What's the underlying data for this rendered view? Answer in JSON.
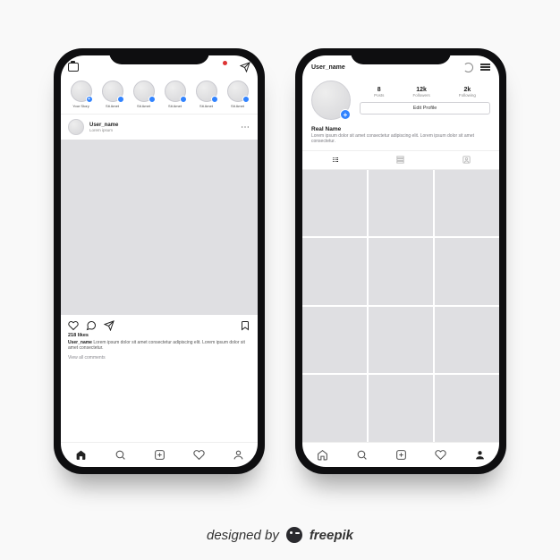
{
  "feed": {
    "stories": [
      {
        "label": "Your Story"
      },
      {
        "label": "Sit Amet"
      },
      {
        "label": "Sit Amet"
      },
      {
        "label": "Sit Amet"
      },
      {
        "label": "Sit Amet"
      },
      {
        "label": "Sit Amet"
      }
    ],
    "post": {
      "username": "User_name",
      "location": "Lorem ipsum",
      "likes_text": "218 likes",
      "caption_user": "User_name",
      "caption_text": "Lorem ipsum dolor sit amet consectetur adipiscing elit. Lorem ipsum dolor sit amet consectetur.",
      "view_comments": "View all comments"
    }
  },
  "profile": {
    "username": "User_name",
    "stats": {
      "posts": {
        "value": "8",
        "label": "Posts"
      },
      "followers": {
        "value": "12k",
        "label": "Followers"
      },
      "following": {
        "value": "2k",
        "label": "Following"
      }
    },
    "edit_button": "Edit Profile",
    "real_name": "Real Name",
    "bio": "Lorem ipsum dolor sit amet consectetur adipiscing elit. Lorem ipsum dolor sit amet consectetur."
  },
  "attribution": {
    "prefix": "designed by ",
    "brand": "freepik"
  }
}
